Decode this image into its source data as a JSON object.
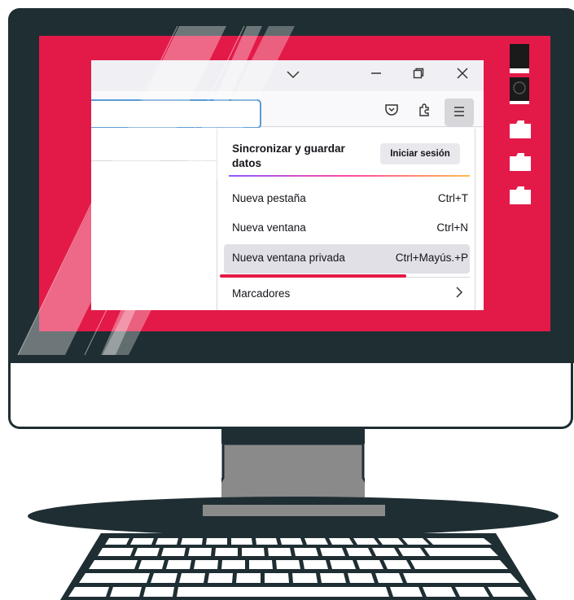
{
  "menu": {
    "sync_label": "Sincronizar y guardar datos",
    "sync_line1": "Sincronizar y guardar",
    "sync_line2": "datos",
    "signin_button": "Iniciar sesión",
    "items": [
      {
        "label": "Nueva pestaña",
        "shortcut": "Ctrl+T"
      },
      {
        "label": "Nueva ventana",
        "shortcut": "Ctrl+N"
      },
      {
        "label": "Nueva ventana privada",
        "shortcut": "Ctrl+Mayús.+P"
      },
      {
        "label": "Marcadores",
        "shortcut": ">"
      }
    ]
  },
  "window_controls": {
    "dropdown": "chevron-down-icon",
    "minimize": "minimize-icon",
    "restore": "restore-icon",
    "close": "close-icon"
  },
  "toolbar_icons": [
    "pocket-icon",
    "extensions-icon",
    "hamburger-menu-icon"
  ],
  "colors": {
    "screen_background": "#e31a48",
    "monitor_frame": "#1f2e33",
    "menu_hover": "#e0e0e6",
    "url_focus": "#5a9bd6"
  }
}
